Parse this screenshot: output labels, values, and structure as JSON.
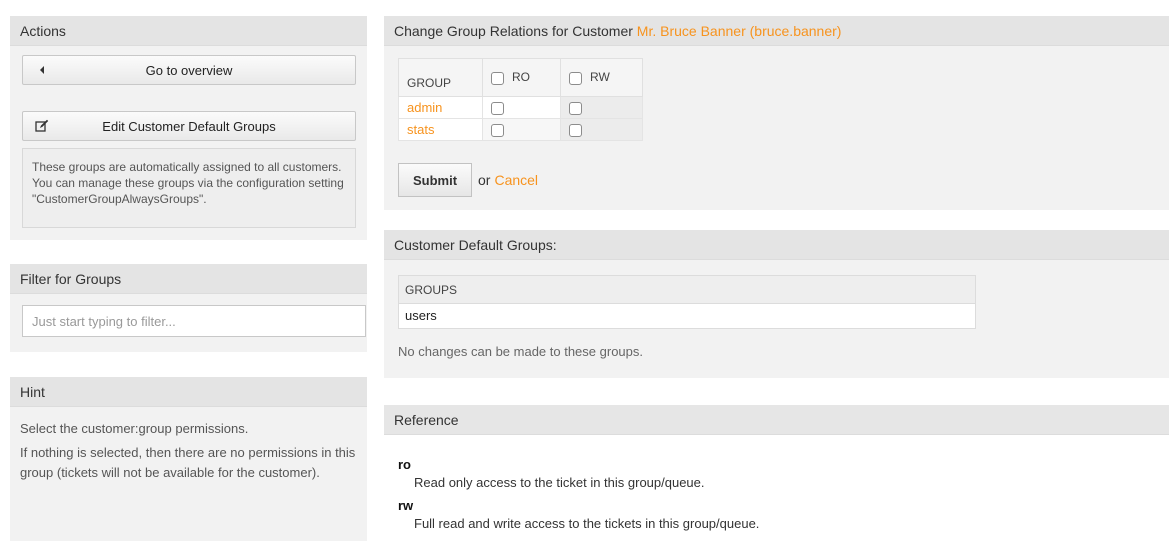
{
  "actions": {
    "title": "Actions",
    "overview_label": "Go to overview",
    "edit_default_label": "Edit Customer Default Groups",
    "description": "These groups are automatically assigned to all customers. You can manage these groups via the configuration setting \"CustomerGroupAlwaysGroups\"."
  },
  "filter": {
    "title": "Filter for Groups",
    "placeholder": "Just start typing to filter..."
  },
  "hint": {
    "title": "Hint",
    "line1": "Select the customer:group permissions.",
    "line2": "If nothing is selected, then there are no permissions in this group (tickets will not be available for the customer)."
  },
  "relations": {
    "title_prefix": "Change Group Relations for Customer",
    "customer_name": "Mr. Bruce Banner (bruce.banner)",
    "headers": {
      "group": "GROUP",
      "ro": "RO",
      "rw": "RW"
    },
    "rows": [
      {
        "name": "admin",
        "ro": false,
        "rw": false
      },
      {
        "name": "stats",
        "ro": false,
        "rw": false
      }
    ],
    "submit_label": "Submit",
    "or_label": "or",
    "cancel_label": "Cancel"
  },
  "default_groups": {
    "title": "Customer Default Groups:",
    "header": "GROUPS",
    "items": [
      "users"
    ],
    "note": "No changes can be made to these groups."
  },
  "reference": {
    "title": "Reference",
    "entries": [
      {
        "term": "ro",
        "desc": "Read only access to the ticket in this group/queue."
      },
      {
        "term": "rw",
        "desc": "Full read and write access to the tickets in this group/queue."
      }
    ]
  },
  "colors": {
    "accent": "#f7931e",
    "header_bg": "#e4e4e4",
    "widget_bg": "#f2f2f2"
  },
  "icons": {
    "overview": "caret-left-icon",
    "edit": "edit-icon"
  }
}
